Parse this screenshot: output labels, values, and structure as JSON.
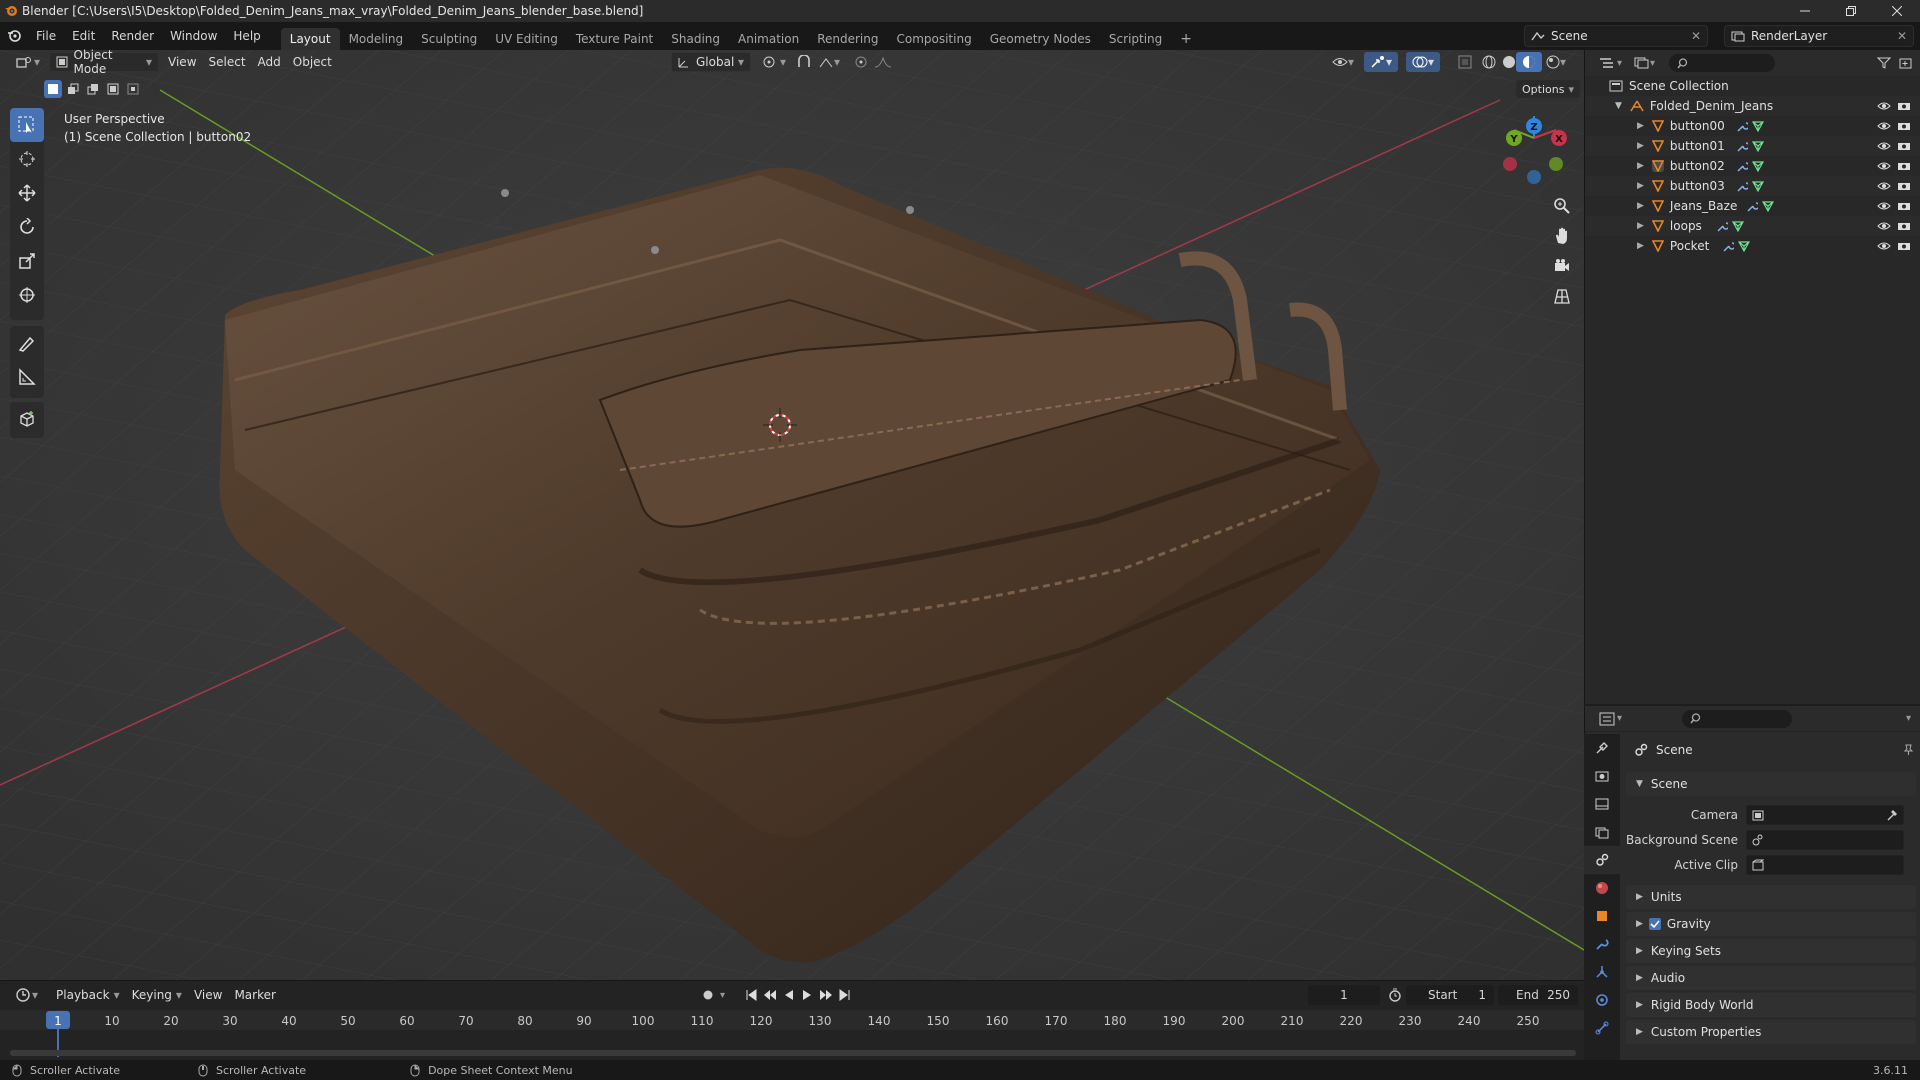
{
  "window": {
    "title": "Blender [C:\\Users\\I5\\Desktop\\Folded_Denim_Jeans_max_vray\\Folded_Denim_Jeans_blender_base.blend]",
    "minimize_icon": "minimize-icon",
    "maximize_icon": "restore-icon",
    "close_icon": "close-icon"
  },
  "menubar": {
    "items": [
      "File",
      "Edit",
      "Render",
      "Window",
      "Help"
    ]
  },
  "workspaces": {
    "tabs": [
      "Layout",
      "Modeling",
      "Sculpting",
      "UV Editing",
      "Texture Paint",
      "Shading",
      "Animation",
      "Rendering",
      "Compositing",
      "Geometry Nodes",
      "Scripting"
    ],
    "active": "Layout",
    "add_label": "+"
  },
  "scene_selector": {
    "value": "Scene"
  },
  "viewlayer_selector": {
    "value": "RenderLayer"
  },
  "viewport": {
    "mode": "Object Mode",
    "menus": [
      "View",
      "Select",
      "Add",
      "Object"
    ],
    "orientation": "Global",
    "options_label": "Options",
    "overlay_line1": "User Perspective",
    "overlay_line2": "(1) Scene Collection | button02",
    "gizmo_labels": {
      "x": "X",
      "y": "Y",
      "z": "Z"
    }
  },
  "outliner": {
    "root": "Scene Collection",
    "collection": "Folded_Denim_Jeans",
    "objects": [
      "button00",
      "button01",
      "button02",
      "button03",
      "Jeans_Baze",
      "loops",
      "Pocket"
    ]
  },
  "properties": {
    "header_title": "Scene",
    "section_scene": "Scene",
    "camera_label": "Camera",
    "background_label": "Background Scene",
    "clip_label": "Active Clip",
    "sections": [
      "Units",
      "Gravity",
      "Keying Sets",
      "Audio",
      "Rigid Body World",
      "Custom Properties"
    ],
    "gravity_checked": true
  },
  "timeline": {
    "menus": [
      "Playback",
      "Keying",
      "View",
      "Marker"
    ],
    "current_frame": "1",
    "start_label": "Start",
    "start_value": "1",
    "end_label": "End",
    "end_value": "250",
    "ticks": [
      "1",
      "10",
      "20",
      "30",
      "40",
      "50",
      "60",
      "70",
      "80",
      "90",
      "100",
      "110",
      "120",
      "130",
      "140",
      "150",
      "160",
      "170",
      "180",
      "190",
      "200",
      "210",
      "220",
      "230",
      "240",
      "250"
    ]
  },
  "statusbar": {
    "item1": "Scroller Activate",
    "item2": "Scroller Activate",
    "item3": "Dope Sheet Context Menu",
    "version": "3.6.11"
  },
  "colors": {
    "accent": "#4772b3",
    "x_axis": "#c8334a",
    "y_axis": "#6fa823",
    "z_axis": "#2e86de",
    "object_orange": "#e8862a"
  }
}
